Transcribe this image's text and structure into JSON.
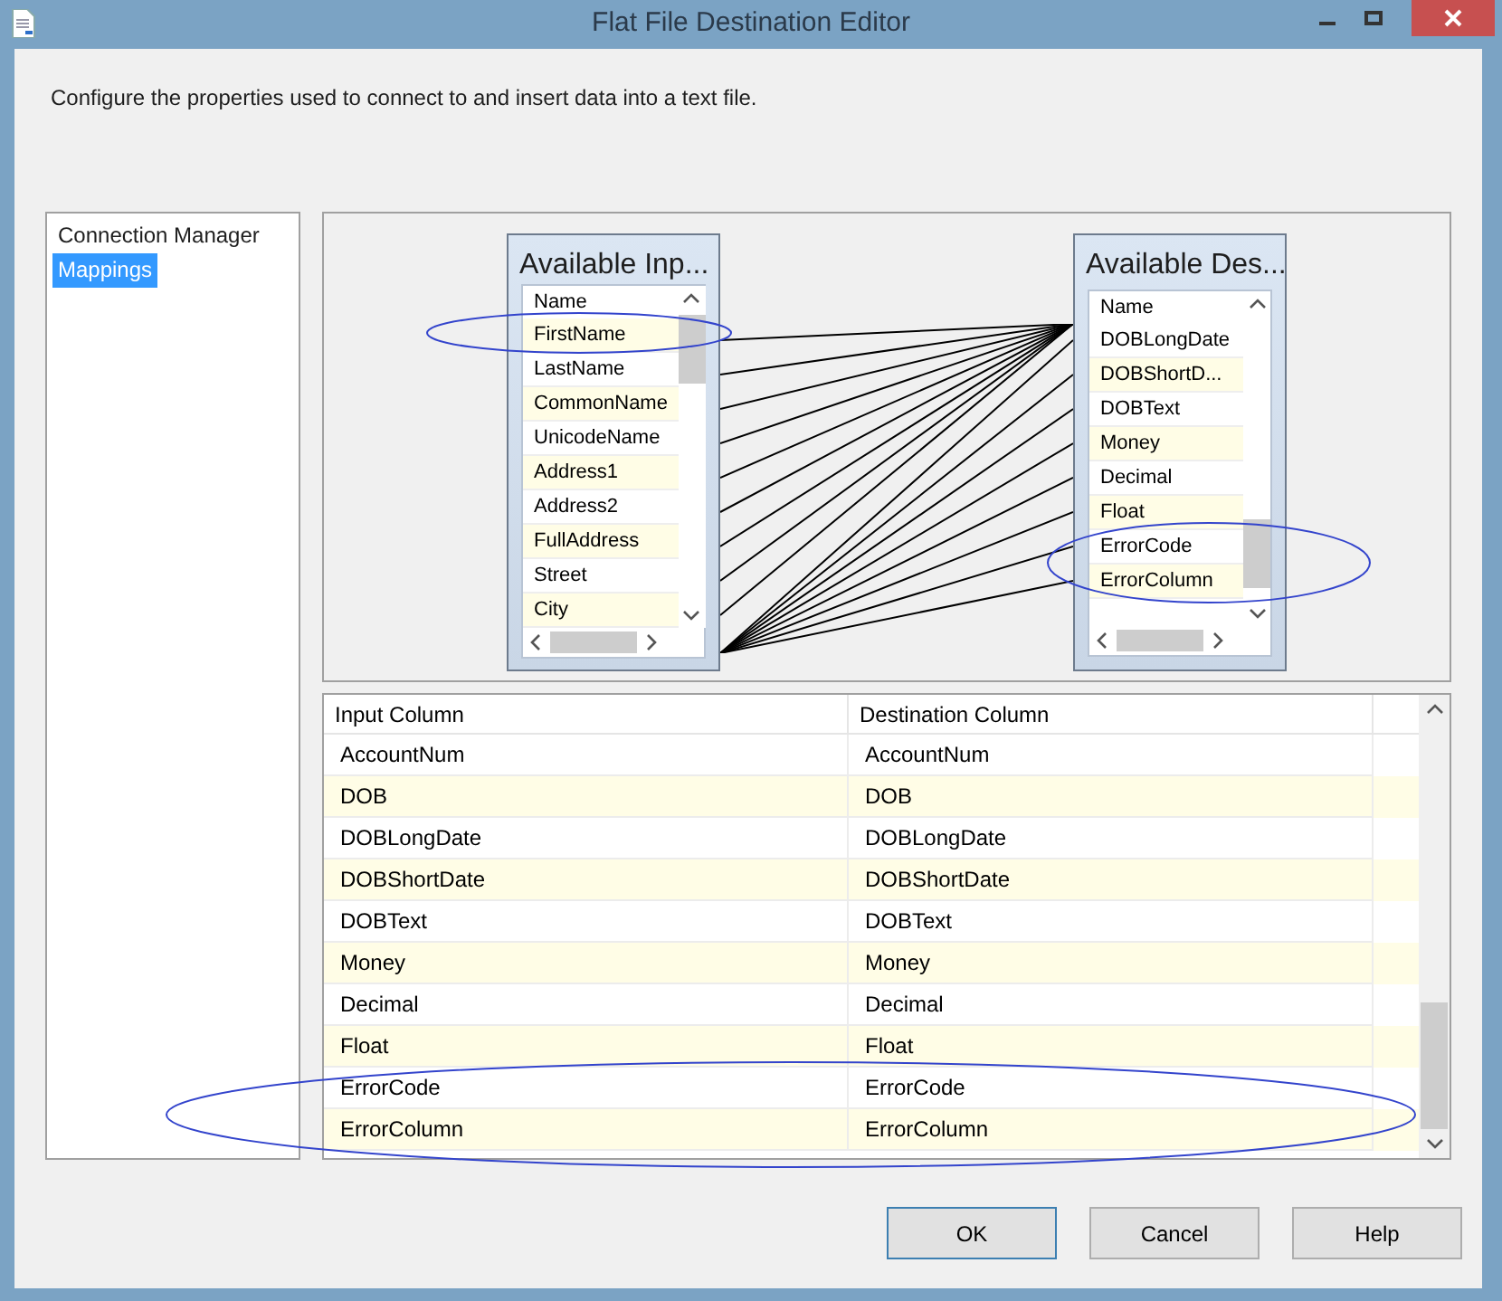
{
  "window": {
    "title": "Flat File Destination Editor"
  },
  "description": "Configure the properties used to connect to and insert data into a text file.",
  "sidebar": {
    "items": [
      {
        "label": "Connection Manager",
        "selected": false
      },
      {
        "label": "Mappings",
        "selected": true
      }
    ]
  },
  "input_table": {
    "title": "Available Inp...",
    "header": "Name",
    "rows": [
      "FirstName",
      "LastName",
      "CommonName",
      "UnicodeName",
      "Address1",
      "Address2",
      "FullAddress",
      "Street",
      "City"
    ]
  },
  "destination_table": {
    "title": "Available Des...",
    "header": "Name",
    "rows": [
      "DOBLongDate",
      "DOBShortD...",
      "DOBText",
      "Money",
      "Decimal",
      "Float",
      "ErrorCode",
      "ErrorColumn"
    ]
  },
  "grid": {
    "columns": [
      "Input Column",
      "Destination Column"
    ],
    "rows": [
      [
        "AccountNum",
        "AccountNum"
      ],
      [
        "DOB",
        "DOB"
      ],
      [
        "DOBLongDate",
        "DOBLongDate"
      ],
      [
        "DOBShortDate",
        "DOBShortDate"
      ],
      [
        "DOBText",
        "DOBText"
      ],
      [
        "Money",
        "Money"
      ],
      [
        "Decimal",
        "Decimal"
      ],
      [
        "Float",
        "Float"
      ],
      [
        "ErrorCode",
        "ErrorCode"
      ],
      [
        "ErrorColumn",
        "ErrorColumn"
      ]
    ]
  },
  "buttons": [
    "OK",
    "Cancel",
    "Help"
  ]
}
